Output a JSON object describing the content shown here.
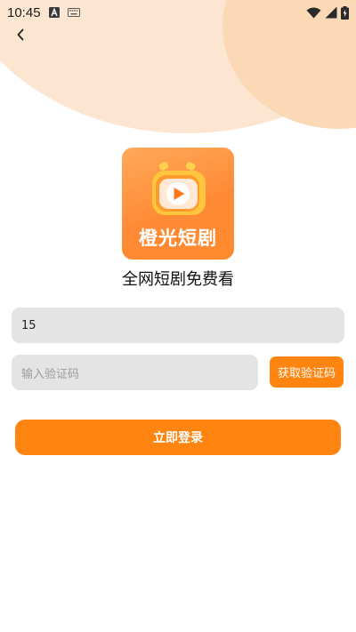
{
  "status_bar": {
    "time": "10:45",
    "icons": [
      "notification-a-icon",
      "keyboard-icon",
      "wifi-icon",
      "signal-icon",
      "battery-charging-icon"
    ]
  },
  "nav": {
    "back_icon": "chevron-left-icon"
  },
  "app": {
    "logo_text": "橙光短剧",
    "slogan": "全网短剧免费看"
  },
  "form": {
    "phone_value": "15",
    "code_placeholder": "输入验证码",
    "get_code_label": "获取验证码",
    "login_label": "立即登录"
  },
  "colors": {
    "accent": "#ff8410",
    "bg_blob_light": "#fde6d1",
    "bg_blob_dark": "#fbd8b6",
    "input_bg": "#e4e4e4"
  }
}
